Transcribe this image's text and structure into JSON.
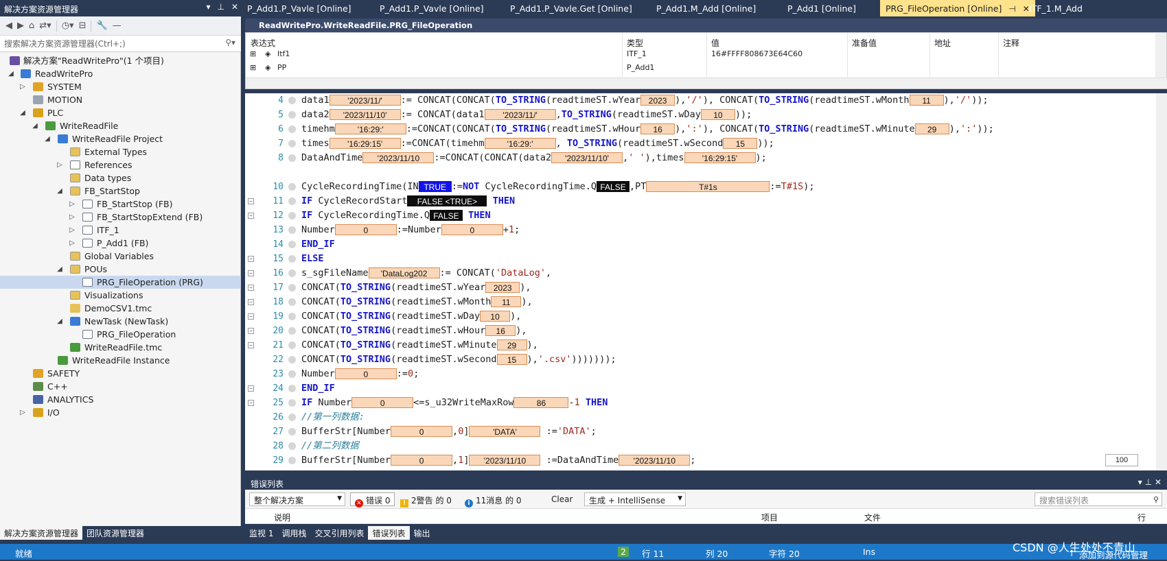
{
  "solution_explorer": {
    "title": "解决方案资源管理器",
    "search_placeholder": "搜索解决方案资源管理器(Ctrl+;)",
    "tree": [
      {
        "label": "解决方案\"ReadWritePro\"(1 个项目)",
        "icon": "solution-icon"
      },
      {
        "label": "ReadWritePro",
        "icon": "project-icon"
      },
      {
        "label": "SYSTEM",
        "icon": "system-icon"
      },
      {
        "label": "MOTION",
        "icon": "motion-icon"
      },
      {
        "label": "PLC",
        "icon": "plc-icon"
      },
      {
        "label": "WriteReadFile",
        "icon": "plc-project-icon"
      },
      {
        "label": "WriteReadFile Project",
        "icon": "project-file-icon"
      },
      {
        "label": "External Types",
        "icon": "folder-icon"
      },
      {
        "label": "References",
        "icon": "references-icon"
      },
      {
        "label": "Data types",
        "icon": "folder-icon"
      },
      {
        "label": "FB_StartStop",
        "icon": "folder-icon"
      },
      {
        "label": "FB_StartStop (FB)",
        "icon": "fb-file-icon"
      },
      {
        "label": "FB_StartStopExtend (FB)",
        "icon": "fb-file-icon"
      },
      {
        "label": "ITF_1",
        "icon": "interface-icon"
      },
      {
        "label": "P_Add1 (FB)",
        "icon": "fb-file-icon"
      },
      {
        "label": "Global Variables",
        "icon": "folder-icon"
      },
      {
        "label": "POUs",
        "icon": "folder-icon"
      },
      {
        "label": "PRG_FileOperation (PRG)",
        "icon": "prg-file-icon"
      },
      {
        "label": "Visualizations",
        "icon": "folder-icon"
      },
      {
        "label": "DemoCSV1.tmc",
        "icon": "warning-file-icon"
      },
      {
        "label": "NewTask (NewTask)",
        "icon": "task-icon"
      },
      {
        "label": "PRG_FileOperation",
        "icon": "prg-file-icon"
      },
      {
        "label": "WriteReadFile.tmc",
        "icon": "tmc-file-icon"
      },
      {
        "label": "WriteReadFile Instance",
        "icon": "instance-icon"
      },
      {
        "label": "SAFETY",
        "icon": "safety-icon"
      },
      {
        "label": "C++",
        "icon": "cpp-icon"
      },
      {
        "label": "ANALYTICS",
        "icon": "analytics-icon"
      },
      {
        "label": "I/O",
        "icon": "io-icon"
      }
    ],
    "bottom_tabs": [
      "解决方案资源管理器",
      "团队资源管理器"
    ]
  },
  "doc_tabs": [
    "P_Add1.P_Vavle [Online]",
    "P_Add1.P_Vavle [Online]",
    "P_Add1.P_Vavle.Get [Online]",
    "P_Add1.M_Add [Online]",
    "P_Add1 [Online]",
    "PRG_FileOperation [Online]",
    "ITF_1.M_Add"
  ],
  "editor": {
    "path": "ReadWritePro.WriteReadFile.PRG_FileOperation",
    "zoom": "100",
    "watch": {
      "headers": [
        "表达式",
        "类型",
        "值",
        "准备值",
        "地址",
        "注释"
      ],
      "rows": [
        {
          "expr": "Itf1",
          "type": "ITF_1",
          "value": "16#FFFF808673E64C60"
        },
        {
          "expr": "PP",
          "type": "P_Add1",
          "value": ""
        }
      ]
    },
    "values": {
      "l4_data1": "'2023/11/'",
      "l4_year": "2023",
      "l4_month": "11",
      "l5_data2": "'2023/11/10'",
      "l5_data1": "'2023/11/'",
      "l5_day": "10",
      "l6_timehm": "'16:29:'",
      "l6_hour": "16",
      "l6_min": "29",
      "l7_times": "'16:29:15'",
      "l7_timehm": "'16:29:'",
      "l7_sec": "15",
      "l8_dat": "'2023/11/10",
      "l8_data2": "'2023/11/10'",
      "l8_times": "'16:29:15'",
      "l10_in": "TRUE",
      "l10_q": "FALSE",
      "l10_pt": "T#1s",
      "l11_start": "FALSE <TRUE>",
      "l12_q": "FALSE",
      "l13_num1": "0",
      "l13_num2": "0",
      "l16_fname": "'DataLog202",
      "l17_year": "2023",
      "l18_month": "11",
      "l19_day": "10",
      "l20_hour": "16",
      "l21_min": "29",
      "l22_sec": "15",
      "l23_num": "0",
      "l25_num": "0",
      "l25_max": "86",
      "l27_num": "0",
      "l27_data": "'DATA'",
      "l29_num": "0",
      "l29_val": "'2023/11/10",
      "l29_dat": "'2023/11/10"
    }
  },
  "error_list": {
    "title": "错误列表",
    "scope": "整个解决方案",
    "errors": "错误 0",
    "warnings": "2警告 的 0",
    "messages": "11消息 的 0",
    "clear": "Clear",
    "build": "生成 + IntelliSense",
    "search_placeholder": "搜索错误列表",
    "columns": [
      "说明",
      "项目",
      "文件",
      "行"
    ],
    "bottom_tabs": [
      "监视 1",
      "调用栈",
      "交叉引用列表",
      "错误列表",
      "输出"
    ]
  },
  "status_bar": {
    "ready": "就绪",
    "badge": "2",
    "line": "行 11",
    "col": "列 20",
    "char": "字符 20",
    "mode": "Ins",
    "watermark": "CSDN @人生处处不青山",
    "source_control": "添加到源代码管理"
  },
  "colors": {
    "accent": "#2b3a55",
    "active_tab": "#ffe28c",
    "status": "#1e78c8",
    "inline_value": "#f9d7b8"
  }
}
